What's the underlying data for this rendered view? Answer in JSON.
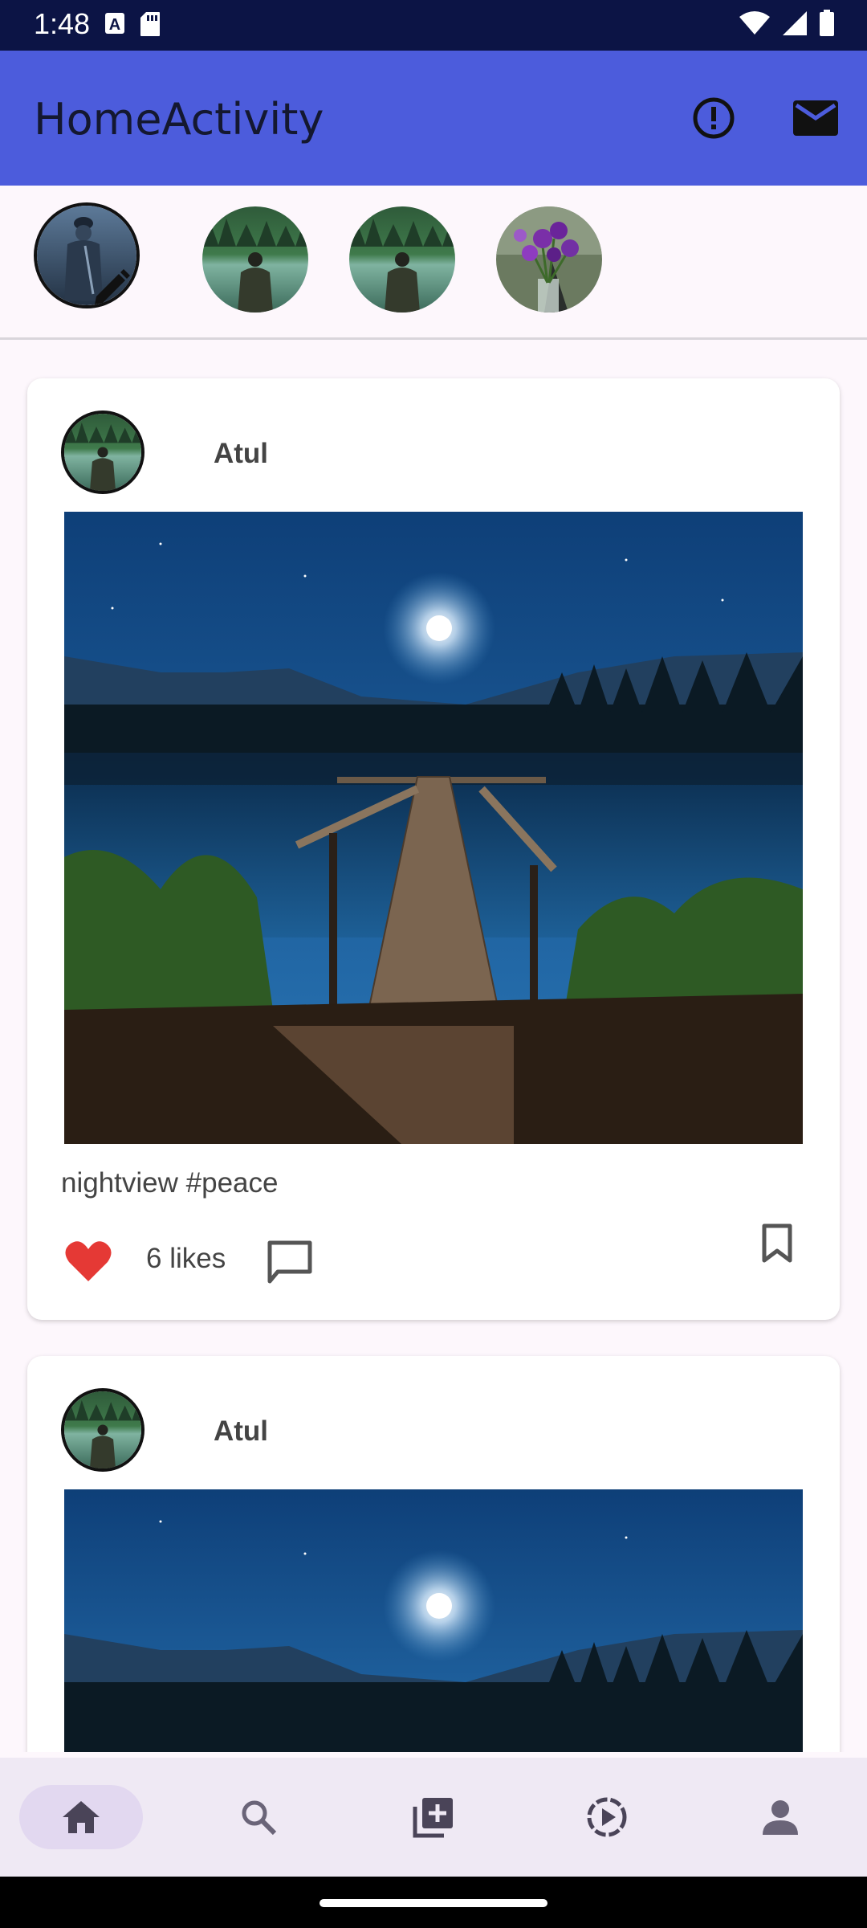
{
  "status_bar": {
    "time": "1:48",
    "left_icons": [
      "a-notification-icon",
      "sd-card-icon"
    ],
    "right_icons": [
      "wifi-icon",
      "signal-icon",
      "battery-icon"
    ]
  },
  "app_bar": {
    "title": "HomeActivity",
    "actions": [
      "info-icon",
      "mail-icon"
    ],
    "color": "#4c5cdc"
  },
  "stories": [
    {
      "name": "my-story",
      "image": "statue-photo",
      "editable": true
    },
    {
      "name": "story-1",
      "image": "person-lake-photo"
    },
    {
      "name": "story-2",
      "image": "person-lake-photo"
    },
    {
      "name": "story-3",
      "image": "flowers-photo"
    }
  ],
  "posts": [
    {
      "author": "Atul",
      "image": "night-lake-pier-photo",
      "caption": "nightview #peace",
      "likes": "6 likes",
      "liked": true
    },
    {
      "author": "Atul",
      "image": "night-lake-pier-photo"
    }
  ],
  "bottom_nav": {
    "items": [
      "home-icon",
      "search-icon",
      "add-post-icon",
      "reels-icon",
      "profile-icon"
    ],
    "active": "home"
  },
  "colors": {
    "accent": "#4c5cdc",
    "like": "#e53935",
    "background": "#fdf7fc"
  }
}
